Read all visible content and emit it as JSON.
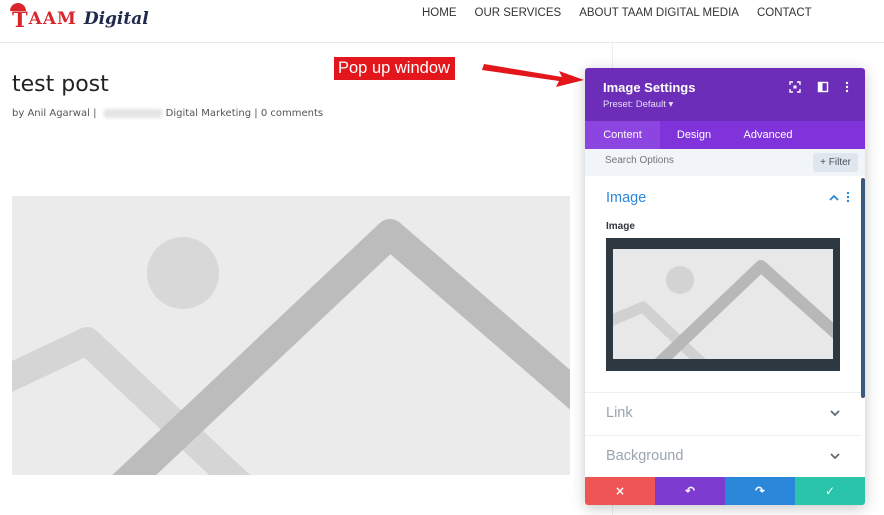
{
  "header": {
    "logo": {
      "letter": "T",
      "rest": "AAM",
      "word": "Digital"
    },
    "nav": [
      {
        "label": "HOME"
      },
      {
        "label": "OUR SERVICES"
      },
      {
        "label": "ABOUT TAAM DIGITAL MEDIA"
      },
      {
        "label": "CONTACT"
      }
    ]
  },
  "post": {
    "title": "test post",
    "meta": {
      "prefix": "by ",
      "author": "Anil Agarwal",
      "sep1": " | ",
      "category": "Digital Marketing",
      "sep2": " | ",
      "comments": "0 comments"
    }
  },
  "annotation": {
    "label": "Pop up window",
    "color": "#e3161b"
  },
  "panel": {
    "title": "Image Settings",
    "preset": "Preset: Default ▾",
    "icons": [
      "expand-icon",
      "sidebar-icon",
      "more-icon"
    ],
    "tabs": [
      {
        "label": "Content",
        "active": true
      },
      {
        "label": "Design",
        "active": false
      },
      {
        "label": "Advanced",
        "active": false
      }
    ],
    "search": {
      "placeholder": "Search Options",
      "filter_label": "+ Filter"
    },
    "section": {
      "title": "Image",
      "field_label": "Image"
    },
    "collapsed": [
      {
        "title": "Link"
      },
      {
        "title": "Background"
      }
    ],
    "footer_buttons": [
      {
        "name": "discard",
        "icon": "×",
        "color": "#ef5555"
      },
      {
        "name": "undo",
        "icon": "↶",
        "color": "#7e3bd0"
      },
      {
        "name": "redo",
        "icon": "↷",
        "color": "#2b87da"
      },
      {
        "name": "save",
        "icon": "✓",
        "color": "#29c4a9"
      }
    ],
    "colors": {
      "header": "#6c2eb9",
      "tabs": "#8133db",
      "accent": "#2b87da"
    }
  }
}
